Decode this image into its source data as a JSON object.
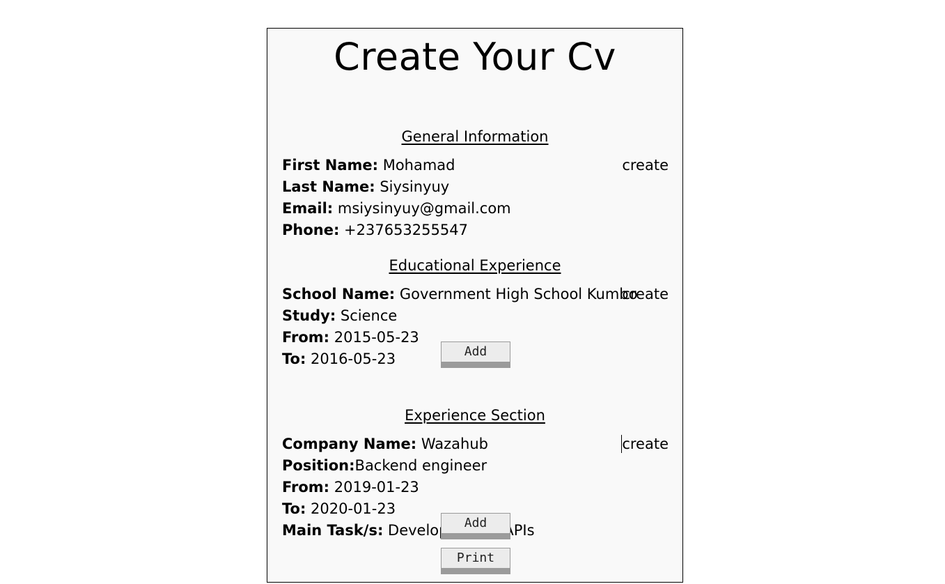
{
  "title": "Create Your Cv",
  "general": {
    "heading": "General Information",
    "create_label": "create",
    "fields": [
      {
        "label": "First Name:",
        "value": " Mohamad"
      },
      {
        "label": "Last Name:",
        "value": " Siysinyuy"
      },
      {
        "label": "Email:",
        "value": " msiysinyuy@gmail.com"
      },
      {
        "label": "Phone:",
        "value": " +237653255547"
      }
    ]
  },
  "education": {
    "heading": "Educational Experience",
    "create_label": "create",
    "add_label": "Add",
    "fields": [
      {
        "label": "School Name:",
        "value": " Government High School Kumbo"
      },
      {
        "label": "Study:",
        "value": " Science"
      },
      {
        "label": "From:",
        "value": " 2015-05-23"
      },
      {
        "label": "To:",
        "value": " 2016-05-23"
      }
    ]
  },
  "experience": {
    "heading": "Experience Section",
    "create_label": "create",
    "add_label": "Add",
    "fields": [
      {
        "label": "Company Name:",
        "value": " Wazahub"
      },
      {
        "label": "Position:",
        "value": "Backend engineer"
      },
      {
        "label": "From:",
        "value": " 2019-01-23"
      },
      {
        "label": "To:",
        "value": " 2020-01-23"
      },
      {
        "label": "Main Task/s:",
        "value": " Developed rest APIs"
      }
    ]
  },
  "print_label": "Print"
}
